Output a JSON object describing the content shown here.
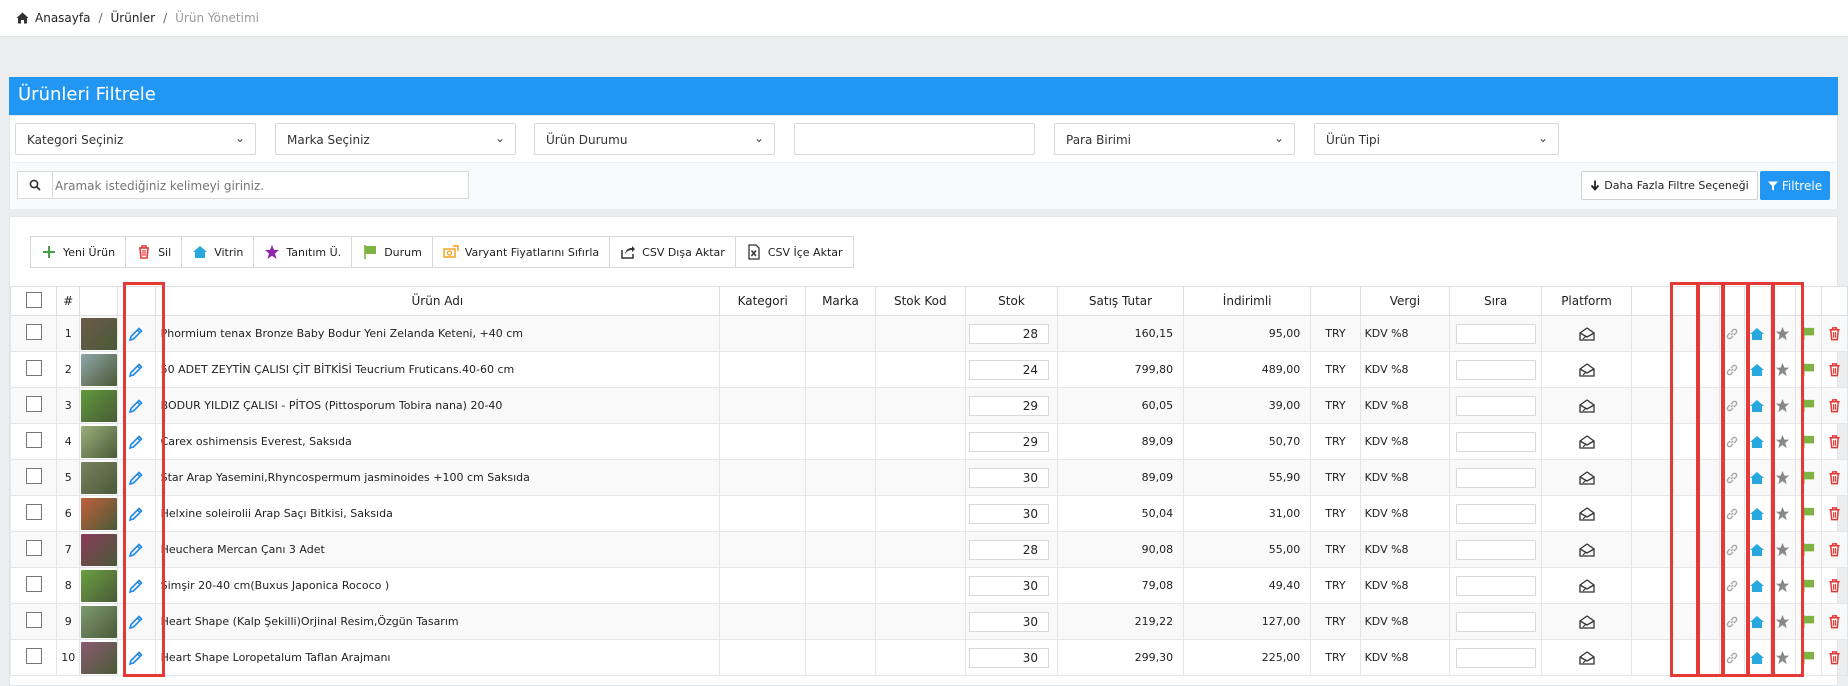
{
  "breadcrumb": {
    "home": "Anasayfa",
    "sep1": "/",
    "products": "Ürünler",
    "sep2": "/",
    "current": "Ürün Yönetimi"
  },
  "filter_panel": {
    "title": "Ürünleri Filtrele",
    "selects": [
      "Kategori Seçiniz",
      "Marka Seçiniz",
      "Ürün Durumu",
      "",
      "Para Birimi",
      "Ürün Tipi"
    ],
    "search_placeholder": "Aramak istediğiniz kelimeyi giriniz.",
    "more_filters_label": "Daha Fazla Filtre Seçeneği",
    "filter_label": "Filtrele"
  },
  "toolbar": {
    "new_product": "Yeni Ürün",
    "delete": "Sil",
    "showcase": "Vitrin",
    "promo": "Tanıtım Ü.",
    "status": "Durum",
    "reset_variant_prices": "Varyant Fiyatlarını Sıfırla",
    "csv_export": "CSV Dışa Aktar",
    "csv_import": "CSV İçe Aktar"
  },
  "table": {
    "headers": {
      "no": "#",
      "name": "Ürün Adı",
      "category": "Kategori",
      "brand": "Marka",
      "stock_code": "Stok Kod",
      "stock": "Stok",
      "price": "Satış Tutar",
      "discounted": "İndirimli",
      "currency": "",
      "tax": "Vergi",
      "order": "Sıra",
      "platform": "Platform"
    },
    "rows": [
      {
        "no": "1",
        "name": "Phormium tenax Bronze Baby Bodur Yeni Zelanda Keteni, +40 cm",
        "stock": "28",
        "price": "160,15",
        "discounted": "95,00",
        "currency": "TRY",
        "tax": "KDV %8",
        "thumb_color": "#6b5a4a"
      },
      {
        "no": "2",
        "name": "50 ADET ZEYTİN ÇALISI ÇİT BİTKİSİ Teucrium Fruticans.40-60 cm",
        "stock": "24",
        "price": "799,80",
        "discounted": "489,00",
        "currency": "TRY",
        "tax": "KDV %8",
        "thumb_color": "#8fa6a8"
      },
      {
        "no": "3",
        "name": "BODUR YILDIZ ÇALISI - PİTOS (Pittosporum Tobira nana) 20-40",
        "stock": "29",
        "price": "60,05",
        "discounted": "39,00",
        "currency": "TRY",
        "tax": "KDV %8",
        "thumb_color": "#5f9a3a"
      },
      {
        "no": "4",
        "name": "Carex oshimensis Everest, Saksıda",
        "stock": "29",
        "price": "89,09",
        "discounted": "50,70",
        "currency": "TRY",
        "tax": "KDV %8",
        "thumb_color": "#9bb07a"
      },
      {
        "no": "5",
        "name": "Star Arap Yasemini,Rhyncospermum jasminoides +100 cm Saksıda",
        "stock": "30",
        "price": "89,09",
        "discounted": "55,90",
        "currency": "TRY",
        "tax": "KDV %8",
        "thumb_color": "#7a8060"
      },
      {
        "no": "6",
        "name": "Helxine soleirolii Arap Saçı Bitkisi, Saksıda",
        "stock": "30",
        "price": "50,04",
        "discounted": "31,00",
        "currency": "TRY",
        "tax": "KDV %8",
        "thumb_color": "#c0603a"
      },
      {
        "no": "7",
        "name": "Heuchera Mercan Çanı 3 Adet",
        "stock": "28",
        "price": "90,08",
        "discounted": "55,00",
        "currency": "TRY",
        "tax": "KDV %8",
        "thumb_color": "#8a3a5a"
      },
      {
        "no": "8",
        "name": "Şimşir 20-40 cm(Buxus Japonica Rococo )",
        "stock": "30",
        "price": "79,08",
        "discounted": "49,40",
        "currency": "TRY",
        "tax": "KDV %8",
        "thumb_color": "#6aa040"
      },
      {
        "no": "9",
        "name": "Heart Shape (Kalp Şekilli)Orjinal Resim,Özgün Tasarım",
        "stock": "30",
        "price": "219,22",
        "discounted": "127,00",
        "currency": "TRY",
        "tax": "KDV %8",
        "thumb_color": "#7d9a70"
      },
      {
        "no": "10",
        "name": "Heart Shape Loropetalum Taflan Arajmanı",
        "stock": "30",
        "price": "299,30",
        "discounted": "225,00",
        "currency": "TRY",
        "tax": "KDV %8",
        "thumb_color": "#8a5a70"
      }
    ]
  },
  "colors": {
    "primary": "#2196f3",
    "highlight_border": "#e53935",
    "edit_icon": "#1e88e5",
    "link_icon": "#aaaaaa",
    "home_icon": "#29a8e0",
    "star_icon": "#888888",
    "flag_icon": "#7cb342",
    "trash_icon": "#e53935"
  }
}
